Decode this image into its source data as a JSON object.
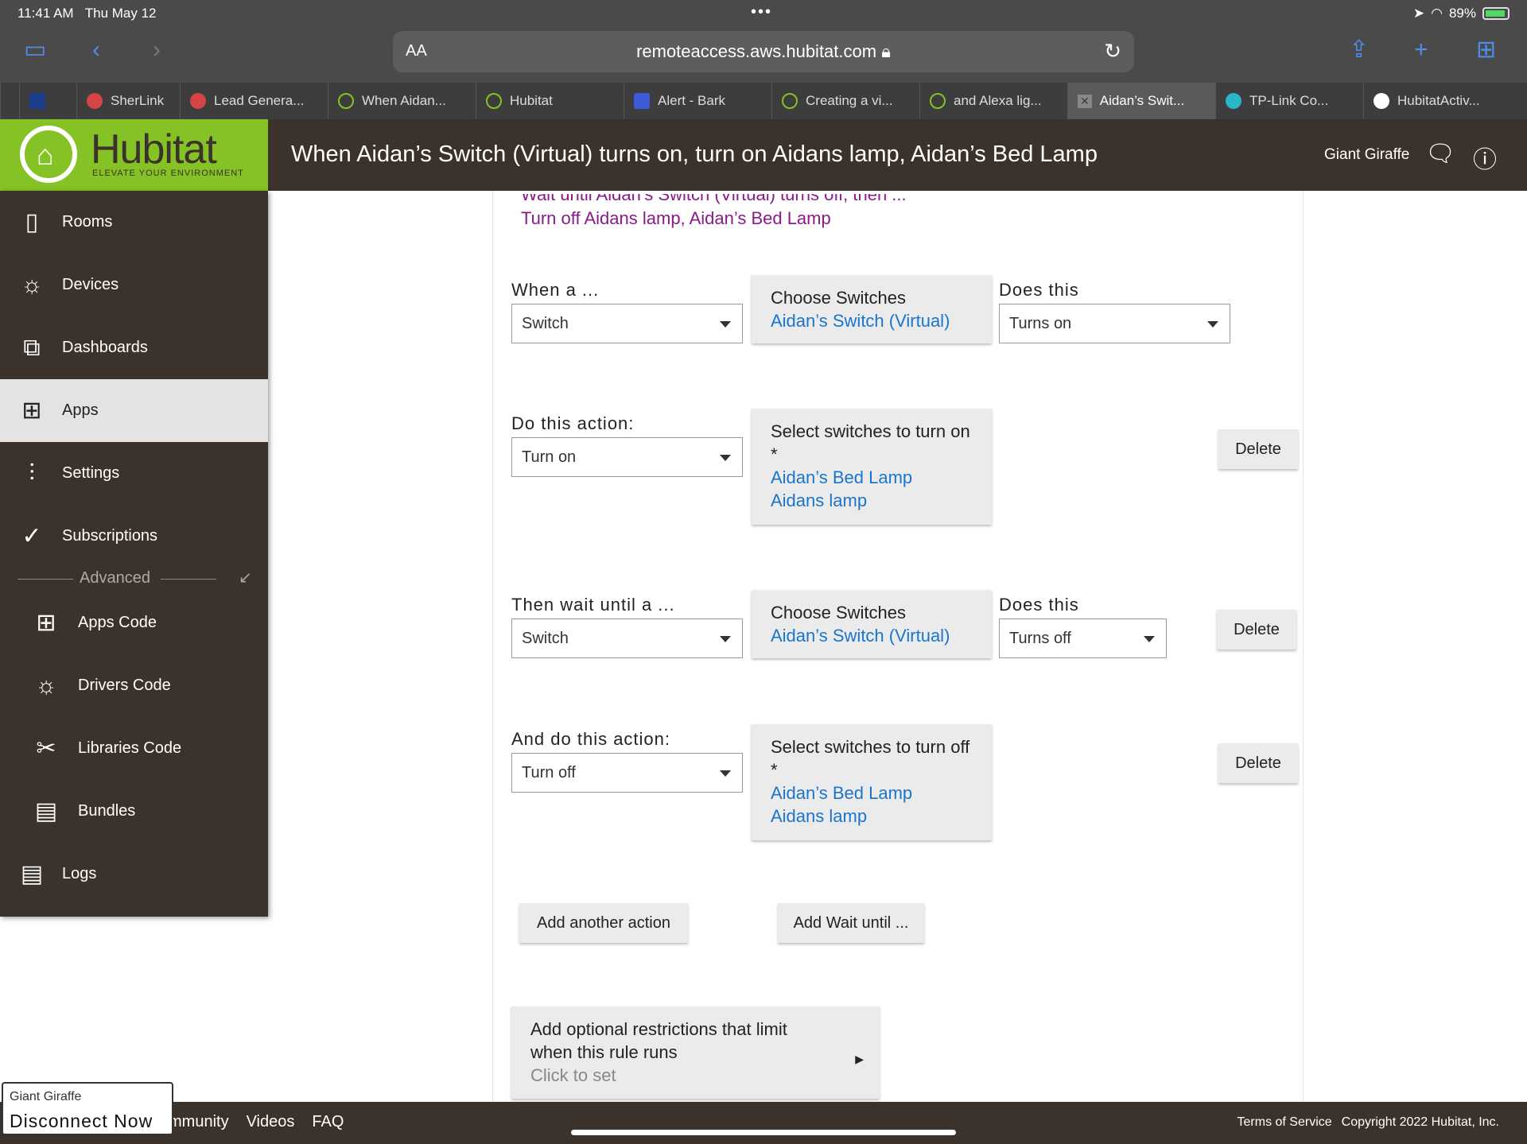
{
  "status": {
    "time": "11:41 AM",
    "date": "Thu May 12",
    "battery": "89%"
  },
  "browser": {
    "aa_label": "AA",
    "url": "remoteaccess.aws.hubitat.com",
    "tabs": [
      {
        "label": "",
        "color": "#4caf50"
      },
      {
        "label": "",
        "color": "#1a3d8f"
      },
      {
        "label": "SherLink",
        "color": "#d64545"
      },
      {
        "label": "Lead Genera...",
        "color": "#d64545"
      },
      {
        "label": "When Aidan...",
        "color": "#84c225"
      },
      {
        "label": "Hubitat",
        "color": "#84c225"
      },
      {
        "label": "Alert - Bark",
        "color": "#3b5bdb"
      },
      {
        "label": "Creating a vi...",
        "color": "#84c225"
      },
      {
        "label": "and Alexa lig...",
        "color": "#84c225"
      },
      {
        "label": "Aidan’s Swit...",
        "color": "#888888"
      },
      {
        "label": "TP-Link Co...",
        "color": "#29b6c9"
      },
      {
        "label": "HubitatActiv...",
        "color": "#ffffff"
      }
    ]
  },
  "header": {
    "logo_name": "Hubitat",
    "logo_tag": "ELEVATE YOUR ENVIRONMENT",
    "title": "When Aidan’s Switch (Virtual) turns on, turn on Aidans lamp, Aidan’s Bed Lamp",
    "user": "Giant Giraffe"
  },
  "sidebar": {
    "items": [
      {
        "label": "Rooms",
        "icon": "rooms-icon"
      },
      {
        "label": "Devices",
        "icon": "bulb-icon"
      },
      {
        "label": "Dashboards",
        "icon": "dashboards-icon"
      },
      {
        "label": "Apps",
        "icon": "apps-icon"
      },
      {
        "label": "Settings",
        "icon": "sliders-icon"
      },
      {
        "label": "Subscriptions",
        "icon": "check-circle-icon"
      }
    ],
    "advanced_label": "Advanced",
    "sub_items": [
      {
        "label": "Apps Code",
        "icon": "apps-code-icon"
      },
      {
        "label": "Drivers Code",
        "icon": "bulb-icon"
      },
      {
        "label": "Libraries Code",
        "icon": "tools-icon"
      },
      {
        "label": "Bundles",
        "icon": "zip-file-icon"
      },
      {
        "label": "Logs",
        "icon": "document-icon"
      }
    ]
  },
  "summary": {
    "line1": "Wait until Aidan’s Switch (Virtual) turns off, then ...",
    "line2": "Turn off Aidans lamp, Aidan’s Bed Lamp"
  },
  "trigger": {
    "label": "When a ...",
    "select": "Switch",
    "choose_title": "Choose Switches",
    "choose_value": "Aidan’s Switch (Virtual)",
    "does_label": "Does this",
    "does_value": "Turns on"
  },
  "action1": {
    "label": "Do this action:",
    "select": "Turn on",
    "choose_title": "Select switches to turn on *",
    "values": [
      "Aidan’s Bed Lamp",
      "Aidans lamp"
    ],
    "delete": "Delete"
  },
  "wait": {
    "label": "Then wait until a ...",
    "select": "Switch",
    "choose_title": "Choose Switches",
    "choose_value": "Aidan’s Switch (Virtual)",
    "does_label": "Does this",
    "does_value": "Turns off",
    "delete": "Delete"
  },
  "action2": {
    "label": "And do this action:",
    "select": "Turn off",
    "choose_title": "Select switches to turn off *",
    "values": [
      "Aidan’s Bed Lamp",
      "Aidans lamp"
    ],
    "delete": "Delete"
  },
  "buttons": {
    "add_action": "Add another action",
    "add_wait": "Add Wait until ..."
  },
  "restrictions": {
    "text": "Add optional restrictions that limit when this rule runs",
    "hint": "Click to set"
  },
  "footer": {
    "links": [
      "mmunity",
      "Videos",
      "FAQ"
    ],
    "terms": "Terms of Service",
    "copyright": "Copyright 2022 Hubitat, Inc."
  },
  "disconnect": {
    "user": "Giant Giraffe",
    "button": "Disconnect Now"
  }
}
